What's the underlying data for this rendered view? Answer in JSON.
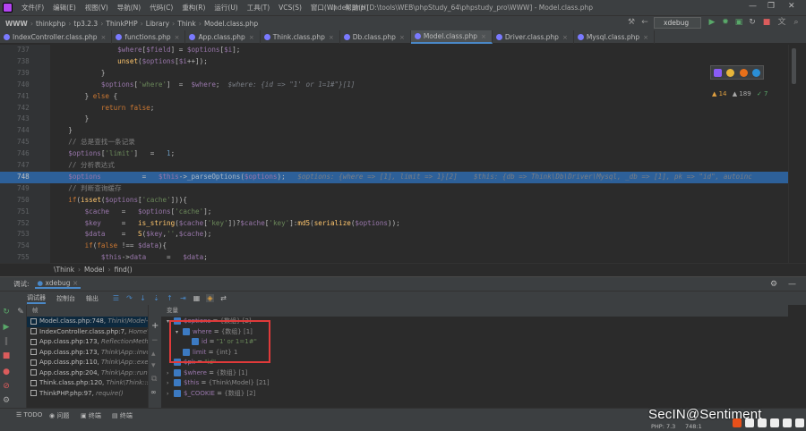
{
  "menubar": {
    "items": [
      "文件(F)",
      "编辑(E)",
      "视图(V)",
      "导航(N)",
      "代码(C)",
      "重构(R)",
      "运行(U)",
      "工具(T)",
      "VCS(S)",
      "窗口(W)",
      "帮助(H)"
    ],
    "window_title": "index.php [D:\\tools\\WEB\\phpStudy_64\\phpstudy_pro\\WWW] - Model.class.php"
  },
  "navbar": {
    "crumbs": [
      "WWW",
      "thinkphp",
      "tp3.2.3",
      "ThinkPHP",
      "Library",
      "Think",
      "Model.class.php"
    ],
    "run_config": "xdebug"
  },
  "tabs": [
    {
      "label": "IndexController.class.php",
      "active": false
    },
    {
      "label": "functions.php",
      "active": false
    },
    {
      "label": "App.class.php",
      "active": false
    },
    {
      "label": "Think.class.php",
      "active": false
    },
    {
      "label": "Db.class.php",
      "active": false
    },
    {
      "label": "Model.class.php",
      "active": true
    },
    {
      "label": "Driver.class.php",
      "active": false
    },
    {
      "label": "Mysql.class.php",
      "active": false
    }
  ],
  "inspections": {
    "warnings": "▲ 14",
    "weak": "▲ 189",
    "typos": "✓ 7"
  },
  "editor": {
    "lines": [
      {
        "n": "737",
        "html": "                <span class=\"v\">$where</span>[<span class=\"v\">$field</span>] = <span class=\"v\">$options</span>[<span class=\"v\">$i</span>];"
      },
      {
        "n": "738",
        "html": "                <span class=\"f\">unset</span>(<span class=\"v\">$options</span>[<span class=\"v\">$i</span>++]);"
      },
      {
        "n": "739",
        "html": "            }"
      },
      {
        "n": "740",
        "html": "            <span class=\"v\">$options</span>[<span class=\"s\">'where'</span>]  =  <span class=\"v\">$where</span>;  <span class=\"i\">$where: {id => \"1' or 1=1#\"}[1]</span>"
      },
      {
        "n": "741",
        "html": "        } <span class=\"k\">else</span> {"
      },
      {
        "n": "742",
        "html": "            <span class=\"k\">return false</span>;"
      },
      {
        "n": "743",
        "html": "        }"
      },
      {
        "n": "744",
        "html": "    }"
      },
      {
        "n": "745",
        "html": "    <span class=\"c\">// 总是查找一条记录</span>"
      },
      {
        "n": "746",
        "html": "    <span class=\"v\">$options</span>[<span class=\"s\">'limit'</span>]   =   <span class=\"n\">1</span>;"
      },
      {
        "n": "747",
        "html": "    <span class=\"c\">// 分析表达式</span>"
      },
      {
        "n": "748",
        "html": "    <span class=\"v\">$options</span>          =   <span class=\"v\">$this</span>-><span class=\"t\">_parseOptions</span>(<span class=\"v\">$options</span>);   <span class=\"i\">$options: {where => [1], limit => 1}[2]    $this: {db => Think\\Db\\Driver\\Mysql, _db => [1], pk => \"id\", autoinc</span>",
        "current": true
      },
      {
        "n": "749",
        "html": "    <span class=\"c\">// 判断查询缓存</span>"
      },
      {
        "n": "750",
        "html": "    <span class=\"k\">if</span>(<span class=\"f\">isset</span>(<span class=\"v\">$options</span>[<span class=\"s\">'cache'</span>])){"
      },
      {
        "n": "751",
        "html": "        <span class=\"v\">$cache</span>   =   <span class=\"v\">$options</span>[<span class=\"s\">'cache'</span>];"
      },
      {
        "n": "752",
        "html": "        <span class=\"v\">$key</span>     =   <span class=\"f\">is_string</span>(<span class=\"v\">$cache</span>[<span class=\"s\">'key'</span>])?<span class=\"v\">$cache</span>[<span class=\"s\">'key'</span>]:<span class=\"f\">md5</span>(<span class=\"f\">serialize</span>(<span class=\"v\">$options</span>));"
      },
      {
        "n": "753",
        "html": "        <span class=\"v\">$data</span>    =   <span class=\"f\">S</span>(<span class=\"v\">$key</span>,<span class=\"s\">''</span>,<span class=\"v\">$cache</span>);"
      },
      {
        "n": "754",
        "html": "        <span class=\"k\">if</span>(<span class=\"k\">false</span> !== <span class=\"v\">$data</span>){"
      },
      {
        "n": "755",
        "html": "            <span class=\"v\">$this</span>-><span class=\"v\">data</span>     =   <span class=\"v\">$data</span>;"
      }
    ]
  },
  "editor_breadcrumb": [
    "\\Think",
    "Model",
    "find()"
  ],
  "debug": {
    "title": "调试:",
    "session": "xdebug",
    "tabs": [
      "调试器",
      "控制台",
      "输出"
    ],
    "frames_header": "帧",
    "vars_header": "变量",
    "frames": [
      {
        "loc": "Model.class.php:748, ",
        "cls": "Think\\Model->find()",
        "sel": true
      },
      {
        "loc": "IndexController.class.php:7, ",
        "cls": "Home\\",
        "sel": false
      },
      {
        "loc": "App.class.php:173, ",
        "cls": "ReflectionMeth",
        "sel": false
      },
      {
        "loc": "App.class.php:173, ",
        "cls": "Think\\App::invo",
        "sel": false
      },
      {
        "loc": "App.class.php:110, ",
        "cls": "Think\\App::exec",
        "sel": false
      },
      {
        "loc": "App.class.php:204, ",
        "cls": "Think\\App::run(",
        "sel": false
      },
      {
        "loc": "Think.class.php:120, ",
        "cls": "Think\\Think::st",
        "sel": false
      },
      {
        "loc": "ThinkPHP.php:97, ",
        "cls": "require()",
        "sel": false
      }
    ],
    "variables": [
      {
        "indent": 0,
        "tw": "▾",
        "name": "$options",
        "eq": " = ",
        "type": "{数组} [2]",
        "val": "",
        "vtype": ""
      },
      {
        "indent": 1,
        "tw": "▾",
        "name": "where",
        "eq": " = ",
        "type": "{数组} [1]",
        "val": "",
        "vtype": ""
      },
      {
        "indent": 2,
        "tw": "",
        "name": "id",
        "eq": " = ",
        "type": "",
        "val": "\"1' or 1=1#\"",
        "vtype": "sv"
      },
      {
        "indent": 1,
        "tw": "",
        "name": "limit",
        "eq": " = ",
        "type": "{int} 1",
        "val": "",
        "vtype": ""
      },
      {
        "indent": 0,
        "tw": "",
        "name": "$pk",
        "eq": " = ",
        "type": "",
        "val": "\"id\"",
        "vtype": "sv"
      },
      {
        "indent": 0,
        "tw": "›",
        "name": "$where",
        "eq": " = ",
        "type": "{数组} [1]",
        "val": "",
        "vtype": ""
      },
      {
        "indent": 0,
        "tw": "›",
        "name": "$this",
        "eq": " = ",
        "type": "{Think\\Model} [21]",
        "val": "",
        "vtype": ""
      },
      {
        "indent": 0,
        "tw": "›",
        "name": "$_COOKIE",
        "eq": " = ",
        "type": "{数组} [2]",
        "val": "",
        "vtype": ""
      }
    ]
  },
  "statusbar": {
    "bottom_tabs": [
      "TODO",
      "问题",
      "终端",
      "终端"
    ],
    "php": "PHP: 7.3",
    "pos": "748:1"
  },
  "watermark": "SecIN@Sentiment"
}
